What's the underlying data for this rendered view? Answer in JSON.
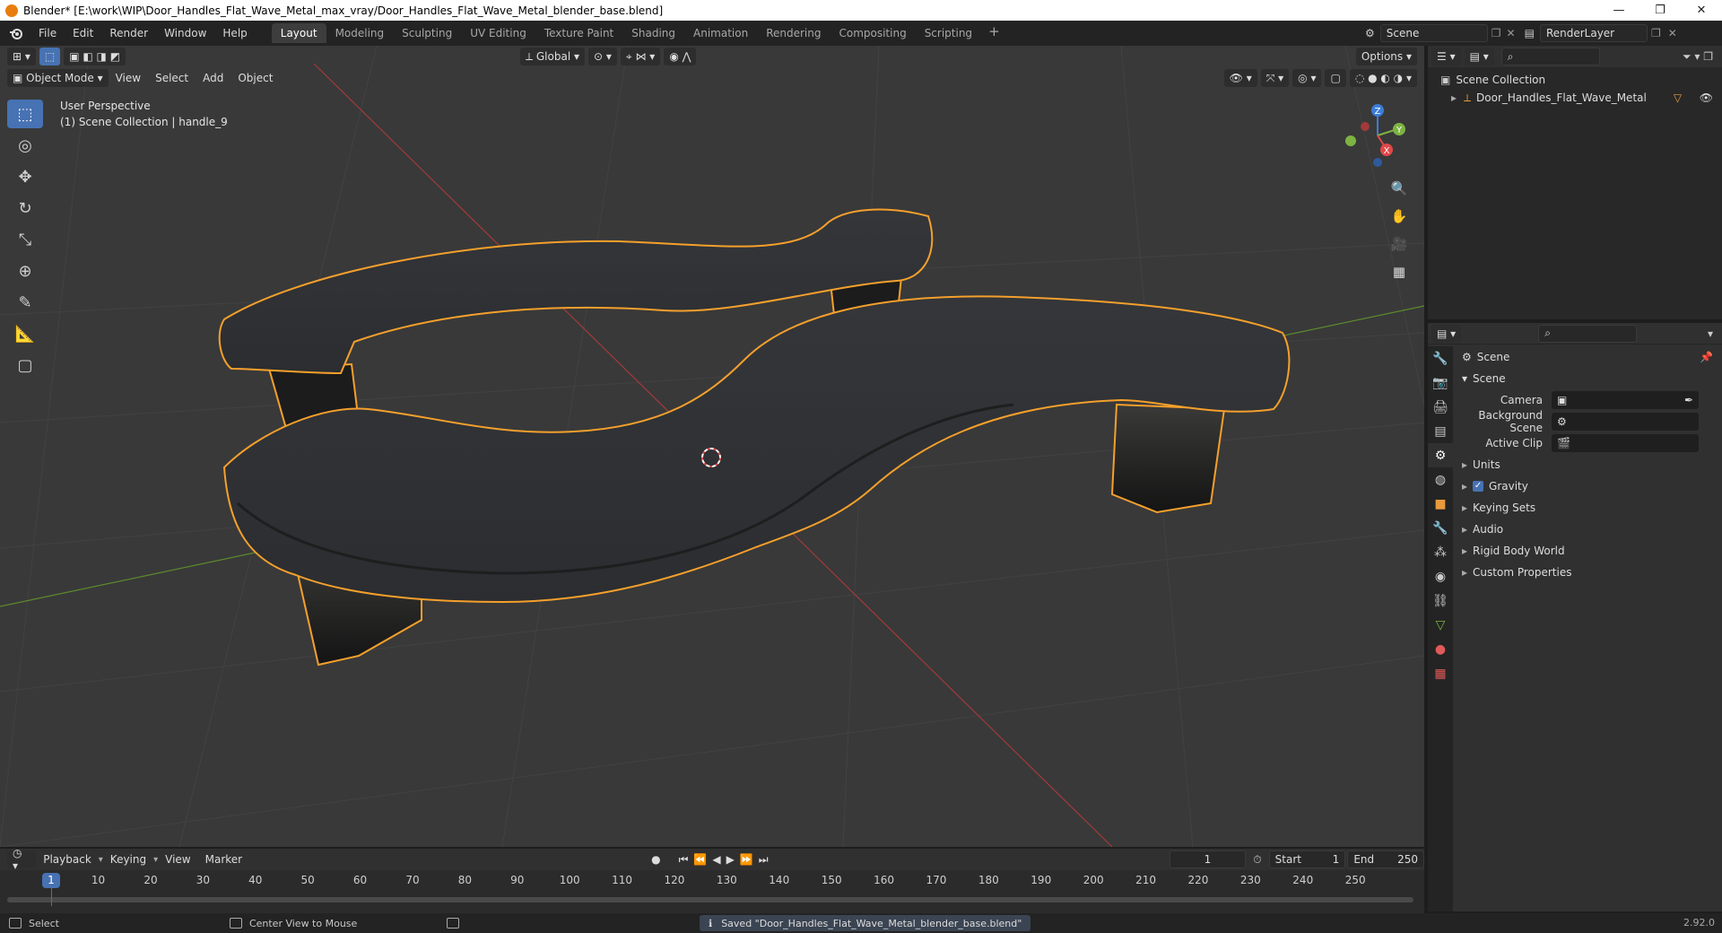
{
  "window": {
    "title": "Blender* [E:\\work\\WIP\\Door_Handles_Flat_Wave_Metal_max_vray/Door_Handles_Flat_Wave_Metal_blender_base.blend]",
    "min": "—",
    "max": "❐",
    "close": "✕"
  },
  "menu": [
    "File",
    "Edit",
    "Render",
    "Window",
    "Help"
  ],
  "workspaces": [
    "Layout",
    "Modeling",
    "Sculpting",
    "UV Editing",
    "Texture Paint",
    "Shading",
    "Animation",
    "Rendering",
    "Compositing",
    "Scripting"
  ],
  "active_workspace": "Layout",
  "scene_name": "Scene",
  "render_layer": "RenderLayer",
  "viewport": {
    "mode": "Object Mode",
    "menus": [
      "View",
      "Select",
      "Add",
      "Object"
    ],
    "transform_orientation": "Global",
    "options_label": "Options",
    "info_line1": "User Perspective",
    "info_line2": "(1) Scene Collection | handle_9"
  },
  "gizmo_axes": {
    "x": "X",
    "y": "Y",
    "z": "Z"
  },
  "outliner": {
    "root": "Scene Collection",
    "items": [
      "Door_Handles_Flat_Wave_Metal"
    ]
  },
  "properties": {
    "context": "Scene",
    "panel": "Scene",
    "fields": [
      {
        "label": "Camera",
        "value": ""
      },
      {
        "label": "Background Scene",
        "value": ""
      },
      {
        "label": "Active Clip",
        "value": ""
      }
    ],
    "subpanels": [
      "Units",
      "Gravity",
      "Keying Sets",
      "Audio",
      "Rigid Body World",
      "Custom Properties"
    ],
    "gravity_checked": true
  },
  "timeline": {
    "menus": [
      "Playback",
      "Keying",
      "View",
      "Marker"
    ],
    "current_frame": "1",
    "start_label": "Start",
    "start": "1",
    "end_label": "End",
    "end": "250",
    "ticks": [
      "1",
      "10",
      "20",
      "30",
      "40",
      "50",
      "60",
      "70",
      "80",
      "90",
      "100",
      "110",
      "120",
      "130",
      "140",
      "150",
      "160",
      "170",
      "180",
      "190",
      "200",
      "210",
      "220",
      "230",
      "240",
      "250"
    ]
  },
  "status": {
    "select": "Select",
    "center_view": "Center View to Mouse",
    "saved_message": "Saved \"Door_Handles_Flat_Wave_Metal_blender_base.blend\"",
    "version": "2.92.0"
  },
  "colors": {
    "accent": "#4772b3",
    "selection_outline": "#f5a02c",
    "viewport_bg": "#393939"
  }
}
